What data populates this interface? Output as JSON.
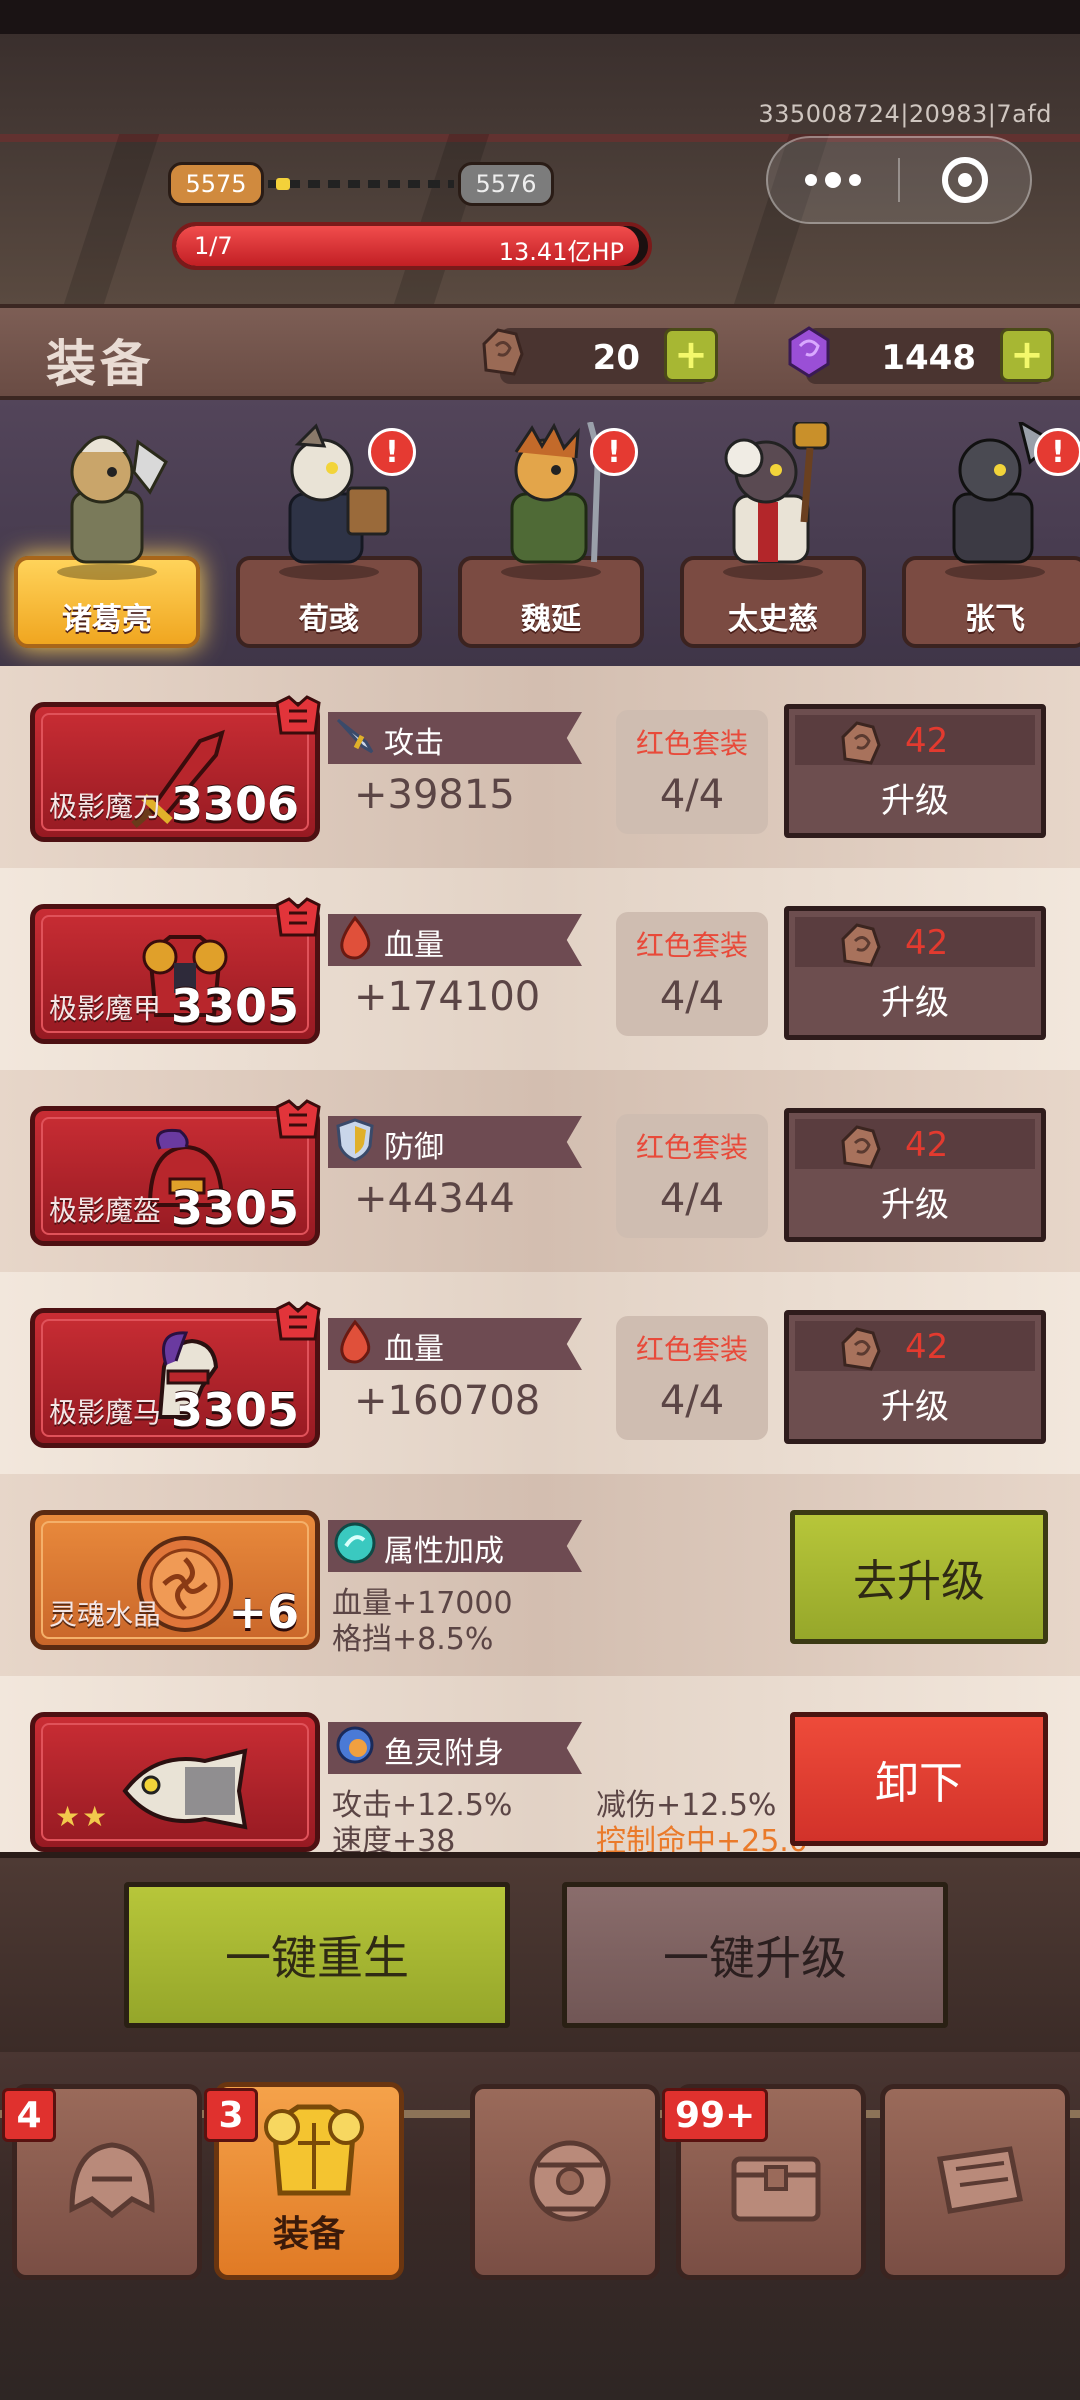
{
  "top": {
    "user_id": "335008724|20983|7afd",
    "level_current": "5575",
    "level_next": "5576",
    "hp_stage": "1/7",
    "hp_value": "13.41亿HP",
    "hp_progress": 0.98
  },
  "header": {
    "title": "装备",
    "stone_count": "20",
    "crystal_count": "1448",
    "plus_symbol": "+"
  },
  "heroes": [
    {
      "name": "诸葛亮",
      "selected": true,
      "alert": false
    },
    {
      "name": "荀彧",
      "selected": false,
      "alert": true
    },
    {
      "name": "魏延",
      "selected": false,
      "alert": true
    },
    {
      "name": "太史慈",
      "selected": false,
      "alert": false
    },
    {
      "name": "张飞",
      "selected": false,
      "alert": true
    }
  ],
  "alert_symbol": "!",
  "equipment": [
    {
      "name": "极影魔刀",
      "level": "3306",
      "stat": "攻击",
      "stat_icon": "sword-icon",
      "value": "+39815",
      "set_name": "红色套装",
      "set_count": "4/4",
      "cost": "42",
      "action": "升级"
    },
    {
      "name": "极影魔甲",
      "level": "3305",
      "stat": "血量",
      "stat_icon": "blood-drop-icon",
      "value": "+174100",
      "set_name": "红色套装",
      "set_count": "4/4",
      "cost": "42",
      "action": "升级"
    },
    {
      "name": "极影魔盔",
      "level": "3305",
      "stat": "防御",
      "stat_icon": "shield-icon",
      "value": "+44344",
      "set_name": "红色套装",
      "set_count": "4/4",
      "cost": "42",
      "action": "升级"
    },
    {
      "name": "极影魔马",
      "level": "3305",
      "stat": "血量",
      "stat_icon": "blood-drop-icon",
      "value": "+160708",
      "set_name": "红色套装",
      "set_count": "4/4",
      "cost": "42",
      "action": "升级"
    }
  ],
  "soul_crystal": {
    "name": "灵魂水晶",
    "level": "+6",
    "tag": "属性加成",
    "lines": [
      "血量+17000",
      "格挡+8.5%"
    ],
    "action": "去升级"
  },
  "fish_spirit": {
    "tag": "鱼灵附身",
    "stars": "★★",
    "lines_left": [
      "攻击+12.5%",
      "速度+38"
    ],
    "lines_right": [
      "减伤+12.5%",
      "控制命中+25.0"
    ],
    "action": "卸下"
  },
  "actions": {
    "rebirth": "一键重生",
    "upgrade_all": "一键升级"
  },
  "nav": [
    {
      "icon": "helmet-tab-icon",
      "badge": "4",
      "label": "",
      "active": false
    },
    {
      "icon": "armor-tab-icon",
      "badge": "3",
      "label": "装备",
      "active": true
    },
    {
      "icon": "gear-orb-tab-icon",
      "badge": "",
      "label": "",
      "active": false
    },
    {
      "icon": "chest-tab-icon",
      "badge": "99+",
      "label": "",
      "active": false
    },
    {
      "icon": "scroll-tab-icon",
      "badge": "",
      "label": "",
      "active": false
    }
  ],
  "colors": {
    "set_red": "#e84a3a",
    "cost_red": "#e23a2f",
    "button_green": "#b7c63a",
    "button_red": "#ee4b3a",
    "active_tab": "#f5a24a"
  }
}
